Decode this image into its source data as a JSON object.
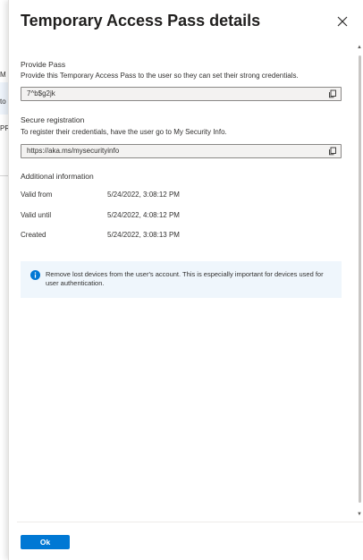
{
  "background": {
    "fragments": [
      "M",
      "to",
      "PR"
    ]
  },
  "panel": {
    "title": "Temporary Access Pass details"
  },
  "provide_pass": {
    "label": "Provide Pass",
    "description": "Provide this Temporary Access Pass to the user so they can set their strong credentials.",
    "value": "7^b$g2jk"
  },
  "secure_registration": {
    "label": "Secure registration",
    "description": "To register their credentials, have the user go to My Security Info.",
    "value": "https://aka.ms/mysecurityinfo"
  },
  "additional_info": {
    "heading": "Additional information",
    "rows": [
      {
        "label": "Valid from",
        "value": "5/24/2022, 3:08:12 PM"
      },
      {
        "label": "Valid until",
        "value": "5/24/2022, 4:08:12 PM"
      },
      {
        "label": "Created",
        "value": "5/24/2022, 3:08:13 PM"
      }
    ]
  },
  "info_bar": {
    "message": "Remove lost devices from the user's account. This is especially important for devices used for user authentication."
  },
  "footer": {
    "ok_label": "Ok"
  },
  "colors": {
    "accent": "#0078d4",
    "info_background": "#eff6fc"
  }
}
